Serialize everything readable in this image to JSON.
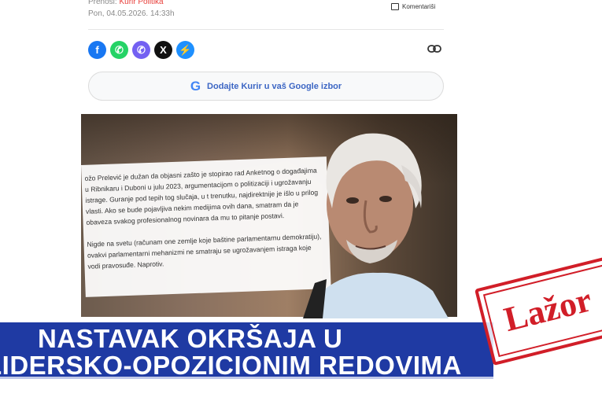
{
  "meta": {
    "source_prefix": "Prenosi: ",
    "source_link": "Kurir Politika",
    "date": "Pon, 04.05.2026. 14:33h",
    "comments_label": "Komentariši"
  },
  "share": {
    "buttons": [
      {
        "icon": "facebook-icon",
        "glyph": "f",
        "color": "#1877f2"
      },
      {
        "icon": "whatsapp-icon",
        "glyph": "✆",
        "color": "#25d366"
      },
      {
        "icon": "viber-icon",
        "glyph": "✆",
        "color": "#7360f2"
      },
      {
        "icon": "x-icon",
        "glyph": "𝕏",
        "color": "#111111"
      },
      {
        "icon": "messenger-icon",
        "glyph": "⚡",
        "color": "#1e90ff"
      }
    ],
    "copy_link_icon": "link-icon"
  },
  "google_button": {
    "logo": "G",
    "label": "Dodajte Kurir u vaš Google izbor"
  },
  "article_card": {
    "paragraph1": "ožo Prelević je dužan da objasni zašto je stopirao rad Anketnog o događajima u Ribnikaru i Duboni u julu 2023, argumentacijom o politizacijі i ugrožavanju istrage. Guranje pod tepih tog slučaja, u t trenutku, najdirektnije je išlo u prilog vlasti. Ako se bude pojavljiva nekim medijima ovih dana, smatram da je obaveza svakog profesionalnog novinara da mu to pitanje postavi.",
    "paragraph2": "Nigde na svetu (računam one zemlje koje baštine parlamentarnu demokratiju), ovakvi parlamentarni mehanizmi ne smatraju se ugrožavanjem istraga koje vodi pravosuđe. Naprotiv."
  },
  "banner": {
    "line1": "NASTAVAK OKRŠAJA U",
    "line2": "LIDERSKO-OPOZICIONIM REDOVIMA",
    "color": "#1f3aa3"
  },
  "stamp": {
    "text": "Lažor",
    "color": "#d11e28"
  }
}
